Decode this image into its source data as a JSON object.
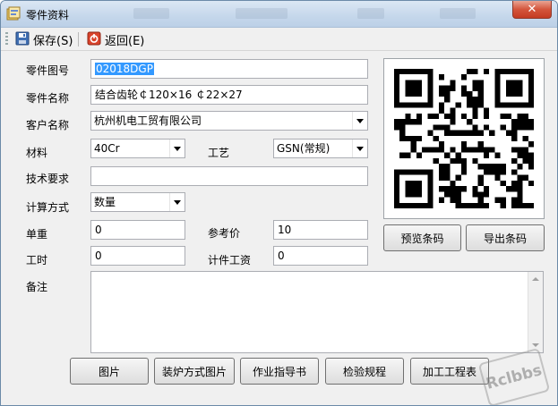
{
  "window": {
    "title": "零件资料",
    "close_glyph": "✕"
  },
  "toolbar": {
    "save_label": "保存(S)",
    "back_label": "返回(E)"
  },
  "form": {
    "part_no_label": "零件图号",
    "part_no_value": "02018DGP",
    "part_name_label": "零件名称",
    "part_name_value": "结合齿轮￠120×16 ￠22×27",
    "customer_label": "客户名称",
    "customer_value": "杭州机电工贸有限公司",
    "material_label": "材料",
    "material_value": "40Cr",
    "process_label": "工艺",
    "process_value": "GSN(常规)",
    "tech_label": "技术要求",
    "tech_value": "",
    "calc_label": "计算方式",
    "calc_value": "数量",
    "unit_weight_label": "单重",
    "unit_weight_value": "0",
    "ref_price_label": "参考价",
    "ref_price_value": "10",
    "work_hours_label": "工时",
    "work_hours_value": "0",
    "piece_wage_label": "计件工资",
    "piece_wage_value": "0",
    "remark_label": "备注",
    "remark_value": ""
  },
  "qr": {
    "preview_label": "预览条码",
    "export_label": "导出条码"
  },
  "bottom_buttons": [
    "图片",
    "装炉方式图片",
    "作业指导书",
    "检验规程",
    "加工工程表"
  ],
  "watermark": "Rclbbs",
  "icons": {
    "title": "app-window-icon",
    "save": "floppy-disk-icon",
    "back": "power-exit-icon"
  },
  "colors": {
    "selection": "#3399ff",
    "close_button": "#c43b22",
    "window_border": "#6b8aa8"
  }
}
